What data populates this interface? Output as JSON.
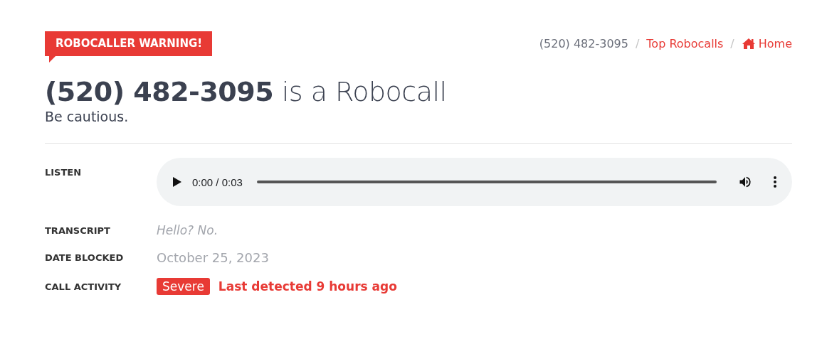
{
  "badge": {
    "text": "ROBOCALLER WARNING!"
  },
  "breadcrumb_separator": "/",
  "breadcrumb": [
    {
      "text": "(520) 482-3095",
      "kind": "current"
    },
    {
      "text": "Top Robocalls",
      "kind": "link"
    },
    {
      "text": "Home",
      "kind": "home"
    }
  ],
  "heading": {
    "number": "(520) 482-3095",
    "rest": "is a Robocall",
    "subtitle": "Be cautious."
  },
  "details": [
    {
      "label": "LISTEN",
      "kind": "audio",
      "time": "0:00 / 0:03",
      "level": 0
    },
    {
      "label": "TRANSCRIPT",
      "kind": "transcript",
      "value": "Hello? No."
    },
    {
      "label": "DATE BLOCKED",
      "kind": "date",
      "value": "October 25, 2023"
    },
    {
      "label": "CALL ACTIVITY",
      "kind": "activity",
      "tag": "Severe",
      "value": "Last detected 9 hours ago"
    }
  ]
}
